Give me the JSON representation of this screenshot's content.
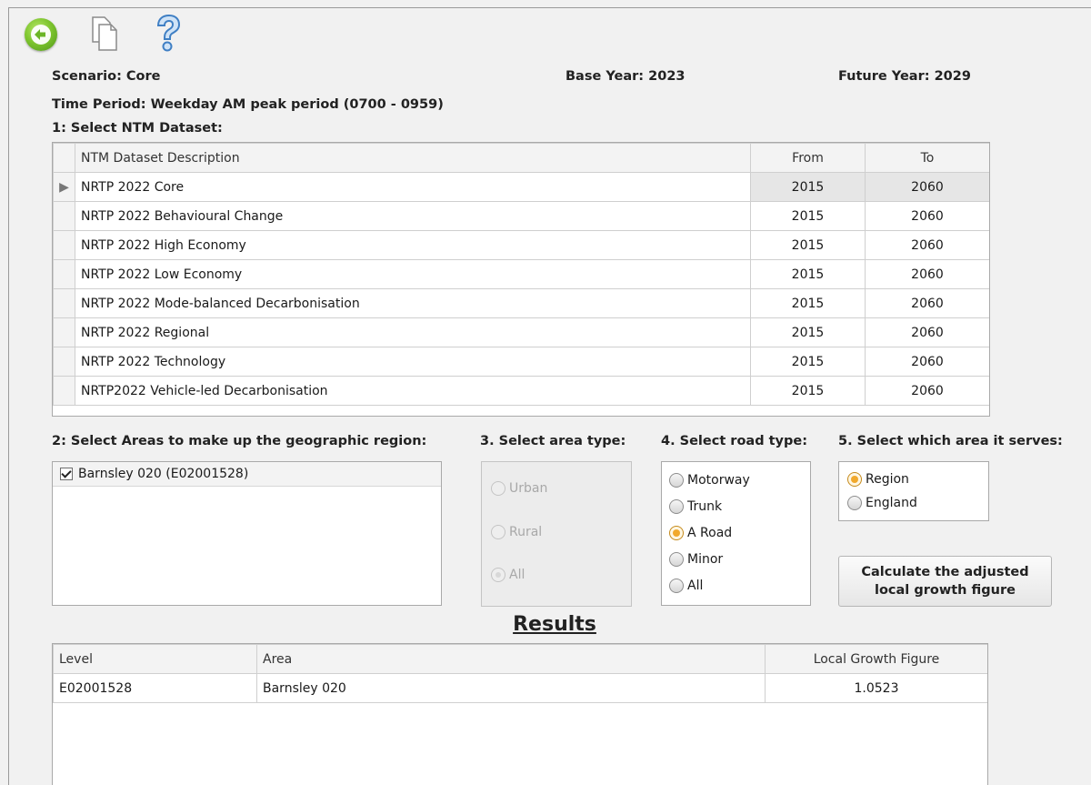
{
  "toolbar": {
    "back_icon": "back-arrow-icon",
    "copy_icon": "copy-document-icon",
    "help_icon": "help-question-icon"
  },
  "header": {
    "scenario": "Scenario: Core",
    "base_year": "Base Year: 2023",
    "future_year": "Future Year: 2029",
    "time_period": "Time Period: Weekday AM peak period (0700 - 0959)"
  },
  "dataset": {
    "label": "1: Select NTM Dataset:",
    "columns": [
      "NTM Dataset Description",
      "From",
      "To"
    ],
    "rows": [
      {
        "description": "NRTP 2022 Core",
        "from": "2015",
        "to": "2060"
      },
      {
        "description": "NRTP 2022 Behavioural Change",
        "from": "2015",
        "to": "2060"
      },
      {
        "description": "NRTP 2022 High Economy",
        "from": "2015",
        "to": "2060"
      },
      {
        "description": "NRTP 2022 Low Economy",
        "from": "2015",
        "to": "2060"
      },
      {
        "description": "NRTP 2022 Mode-balanced Decarbonisation",
        "from": "2015",
        "to": "2060"
      },
      {
        "description": "NRTP 2022 Regional",
        "from": "2015",
        "to": "2060"
      },
      {
        "description": "NRTP 2022 Technology",
        "from": "2015",
        "to": "2060"
      },
      {
        "description": "NRTP2022 Vehicle-led Decarbonisation",
        "from": "2015",
        "to": "2060"
      }
    ]
  },
  "areas": {
    "label": "2: Select Areas to make up the geographic region:",
    "items": [
      {
        "label": "Barnsley 020 (E02001528)",
        "checked": true
      }
    ]
  },
  "area_type": {
    "label": "3. Select area type:",
    "options": [
      "Urban",
      "Rural",
      "All"
    ],
    "selected": "All",
    "enabled": false
  },
  "road_type": {
    "label": "4. Select road type:",
    "options": [
      "Motorway",
      "Trunk",
      "A Road",
      "Minor",
      "All"
    ],
    "selected": "A Road"
  },
  "serves": {
    "label": "5. Select which area it serves:",
    "options": [
      "Region",
      "England"
    ],
    "selected": "Region"
  },
  "calculate_button": {
    "line1": "Calculate the adjusted",
    "line2": "local growth figure"
  },
  "results": {
    "title": "Results",
    "columns": [
      "Level",
      "Area",
      "Local Growth Figure"
    ],
    "rows": [
      {
        "level": "E02001528",
        "area": "Barnsley 020",
        "growth": "1.0523"
      }
    ]
  },
  "colors": {
    "accent_radio": "#f1a92d",
    "back_button": "#7fc62f",
    "help_icon": "#5b9bd5"
  }
}
